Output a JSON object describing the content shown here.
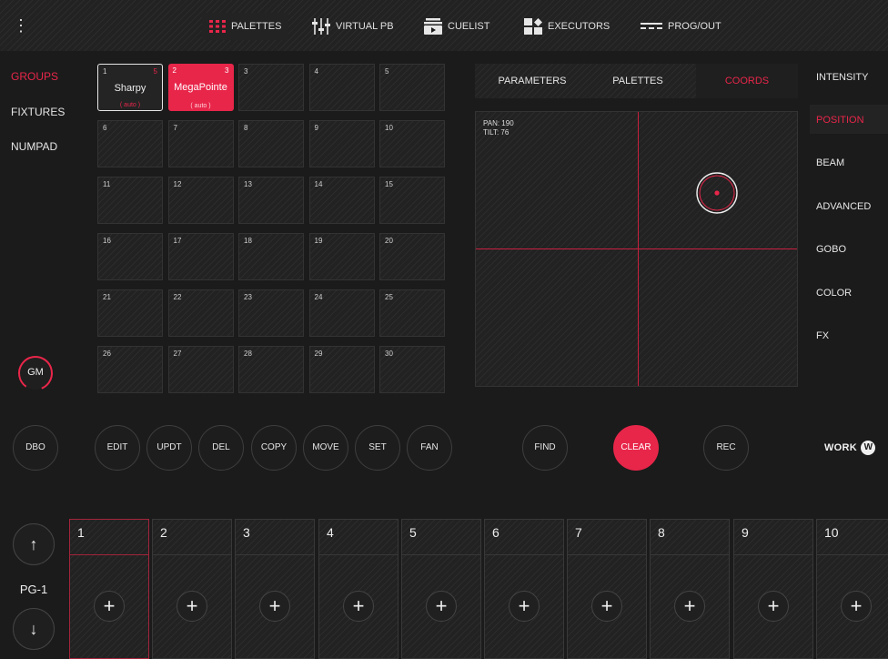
{
  "topbar": {
    "menu_glyph": "⋮",
    "nav": [
      {
        "label": "PALETTES",
        "icon": "grid-icon"
      },
      {
        "label": "VIRTUAL PB",
        "icon": "faders-icon"
      },
      {
        "label": "CUELIST",
        "icon": "cuelist-icon"
      },
      {
        "label": "EXECUTORS",
        "icon": "executors-icon"
      },
      {
        "label": "PROG/OUT",
        "icon": "prog-out-icon"
      }
    ]
  },
  "leftnav": {
    "items": [
      "GROUPS",
      "FIXTURES",
      "NUMPAD"
    ],
    "active": 0
  },
  "gm_label": "GM",
  "groups": {
    "cells": [
      {
        "num": "1",
        "name": "Sharpy",
        "count": "5",
        "auto": "( auto )"
      },
      {
        "num": "2",
        "name": "MegaPointe",
        "count": "3",
        "auto": "( auto )"
      },
      {
        "num": "3"
      },
      {
        "num": "4"
      },
      {
        "num": "5"
      },
      {
        "num": "6"
      },
      {
        "num": "7"
      },
      {
        "num": "8"
      },
      {
        "num": "9"
      },
      {
        "num": "10"
      },
      {
        "num": "11"
      },
      {
        "num": "12"
      },
      {
        "num": "13"
      },
      {
        "num": "14"
      },
      {
        "num": "15"
      },
      {
        "num": "16"
      },
      {
        "num": "17"
      },
      {
        "num": "18"
      },
      {
        "num": "19"
      },
      {
        "num": "20"
      },
      {
        "num": "21"
      },
      {
        "num": "22"
      },
      {
        "num": "23"
      },
      {
        "num": "24"
      },
      {
        "num": "25"
      },
      {
        "num": "26"
      },
      {
        "num": "27"
      },
      {
        "num": "28"
      },
      {
        "num": "29"
      },
      {
        "num": "30"
      }
    ]
  },
  "param_tabs": {
    "items": [
      "PARAMETERS",
      "PALETTES",
      "COORDS"
    ],
    "active": 2
  },
  "coords": {
    "pan_text": "PAN: 190",
    "tilt_text": "TILT: 76"
  },
  "categories": {
    "items": [
      "INTENSITY",
      "POSITION",
      "BEAM",
      "ADVANCED",
      "GOBO",
      "COLOR",
      "FX"
    ],
    "active": 1
  },
  "actions": {
    "dbo": "DBO",
    "edit_group": [
      "EDIT",
      "UPDT",
      "DEL",
      "COPY",
      "MOVE",
      "SET",
      "FAN"
    ],
    "find": "FIND",
    "clear": "CLEAR",
    "rec": "REC"
  },
  "brand": "WORK",
  "executors": {
    "page": "PG-1",
    "items": [
      "1",
      "2",
      "3",
      "4",
      "5",
      "6",
      "7",
      "8",
      "9",
      "10"
    ],
    "plus": "+"
  },
  "colors": {
    "accent": "#e8264a",
    "background": "#1b1b1b"
  }
}
